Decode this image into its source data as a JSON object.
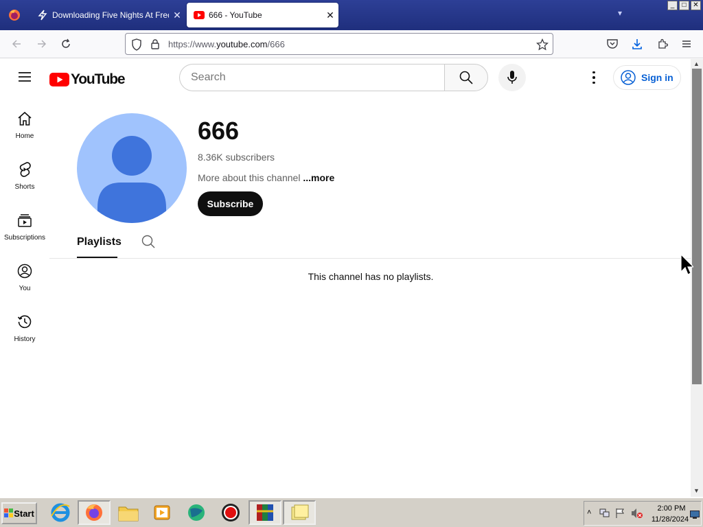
{
  "browser": {
    "tabs": [
      {
        "title": "Downloading Five Nights At Freddy",
        "active": false
      },
      {
        "title": "666 - YouTube",
        "active": true
      }
    ],
    "url_prefix": "https://www.",
    "url_domain": "youtube.com",
    "url_path": "/666",
    "window_controls": [
      "_",
      "□",
      "✕"
    ]
  },
  "youtube": {
    "logo_text": "YouTube",
    "search_placeholder": "Search",
    "signin_label": "Sign in",
    "sidebar": [
      {
        "label": "Home",
        "icon": "home-icon"
      },
      {
        "label": "Shorts",
        "icon": "shorts-icon"
      },
      {
        "label": "Subscriptions",
        "icon": "subscriptions-icon"
      },
      {
        "label": "You",
        "icon": "you-icon"
      },
      {
        "label": "History",
        "icon": "history-icon"
      }
    ],
    "channel": {
      "name": "666",
      "subscribers": "8.36K subscribers",
      "about": "More about this channel",
      "more": "...more",
      "subscribe_label": "Subscribe"
    },
    "tabs": {
      "playlists": "Playlists"
    },
    "empty_message": "This channel has no playlists."
  },
  "taskbar": {
    "start_label": "Start",
    "time": "2:00 PM",
    "date": "11/28/2024"
  },
  "colors": {
    "youtube_red": "#ff0000",
    "link_blue": "#065fd4",
    "avatar_bg": "#a0c3fd",
    "avatar_fg": "#3f74dc"
  }
}
